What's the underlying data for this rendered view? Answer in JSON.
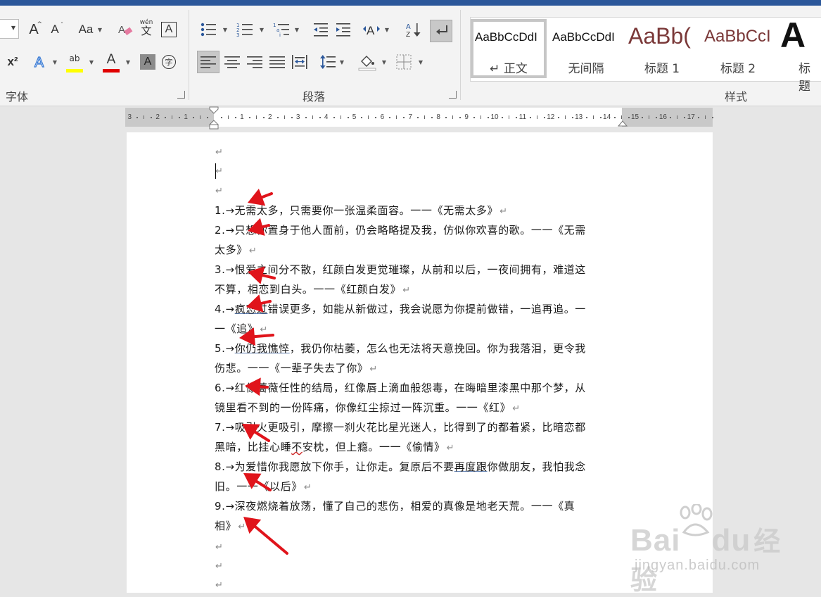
{
  "ribbon": {
    "groups": {
      "font": "字体",
      "paragraph": "段落",
      "styles": "样式"
    },
    "font_buttons": {
      "grow": "A",
      "shrink": "A",
      "change_case": "Aa",
      "phonetic_top": "wén",
      "phonetic_bottom": "文",
      "border_char": "A",
      "superscript": "x²",
      "highlight": "ab",
      "font_color": "A",
      "shading": "A",
      "enclose": "字"
    },
    "accent_colors": {
      "highlight": "#ffff00",
      "font_color": "#e00000",
      "title_bar": "#2b579a"
    },
    "styles": [
      {
        "preview": "AaBbCcDdI",
        "name": "↵ 正文",
        "selected": true
      },
      {
        "preview": "AaBbCcDdI",
        "name": "无间隔",
        "selected": false
      },
      {
        "preview": "AaBb(",
        "name": "标题 1",
        "selected": false
      },
      {
        "preview": "AaBbCcI",
        "name": "标题 2",
        "selected": false
      },
      {
        "preview": "A",
        "name": "标题",
        "selected": false
      }
    ]
  },
  "ruler": {
    "left_ticks": [
      "3",
      "2",
      "1"
    ],
    "ticks": [
      "1",
      "2",
      "3",
      "4",
      "5",
      "6",
      "7",
      "8",
      "9",
      "10",
      "11",
      "12",
      "13",
      "14",
      "15",
      "16",
      "17"
    ]
  },
  "document": {
    "empty_mark": "↵",
    "lines": [
      [
        {
          "t": "1.→无需太多，只需要你一张温柔面容。一一《无需太多》"
        }
      ],
      [
        {
          "t": "2.→只想你置身于他人面前，仍会略略提及我，仿似你欢喜的歌。一一《无需"
        }
      ],
      [
        {
          "t": "太多》"
        }
      ],
      [
        {
          "t": "3.→恨爱之间分不散，红颜白发更觉璀璨，从前和以后，一夜间拥有，难道这"
        }
      ],
      [
        {
          "t": "不算，相恋到白头。一一《红颜白发》"
        }
      ],
      [
        {
          "t": "4.→"
        },
        {
          "t": "疯恋过",
          "u": true
        },
        {
          "t": "错误更多，如能从新做过，我会说愿为你提前做错，一追再追。一"
        }
      ],
      [
        {
          "t": "一《追》"
        }
      ],
      [
        {
          "t": "5.→"
        },
        {
          "t": "你仍我憔悴",
          "u": true
        },
        {
          "t": "，我仍你枯萎，怎么也无法将天意挽回。你为我落泪，更令我"
        }
      ],
      [
        {
          "t": "伤悲。一一《一辈子失去了你》"
        }
      ],
      [
        {
          "t": "6.→红像蔷薇任性的结局，红像唇上滴血般怨毒，在晦暗里漆黑中那个梦，从"
        }
      ],
      [
        {
          "t": "镜里看不到的一份阵痛，你像红尘掠过一阵沉重。一一《红》"
        }
      ],
      [
        {
          "t": "7.→吸引火更吸引，摩擦一刹火花比星光迷人，比得到了的都着紧，比暗恋都"
        }
      ],
      [
        {
          "t": "黑暗，比挂心睡"
        },
        {
          "t": "不",
          "w": true
        },
        {
          "t": "安枕，但上瘾。一一《偷情》"
        }
      ],
      [
        {
          "t": "8.→为爱惜你我愿放下你手，让你走。复原后不要"
        },
        {
          "t": "再度跟",
          "u": true
        },
        {
          "t": "你做朋友，我怕我念"
        }
      ],
      [
        {
          "t": "旧。一一《以后》"
        }
      ],
      [
        {
          "t": "9.→深夜燃烧着放荡，懂了自己的悲伤，相爱的真像是地老天荒。一一《真"
        }
      ],
      [
        {
          "t": "相》"
        }
      ]
    ]
  },
  "annotation_color": "#e0141b",
  "watermark": {
    "brand": "Bai",
    "brand_tail": "du",
    "cn": "经验",
    "url": "jingyan.baidu.com"
  }
}
